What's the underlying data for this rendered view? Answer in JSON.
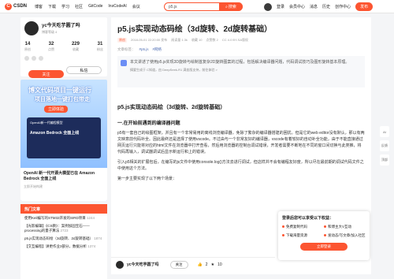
{
  "topbar": {
    "logo": "CSDN",
    "nav": [
      "博客",
      "下载",
      "学习",
      "社区",
      "GitCode",
      "InsCodeAI",
      "会议"
    ],
    "search_value": "p5.js",
    "search_button": "搜索",
    "right_items": [
      "登录",
      "会员中心",
      "消息",
      "历史",
      "创作中心"
    ],
    "publish": "发布"
  },
  "profile": {
    "name": "yc今天吃芋圆了吗",
    "sub": "博客等级 4",
    "stats": [
      {
        "n": "14",
        "l": "原创"
      },
      {
        "n": "32",
        "l": "点赞"
      },
      {
        "n": "229",
        "l": "收藏"
      },
      {
        "n": "31",
        "l": "粉丝"
      }
    ],
    "follow": "关注",
    "message": "私信"
  },
  "ad": {
    "title1": "博文代码项目一键运行",
    "title2": "项目落地一键打包带走",
    "badge": "立即体验",
    "card_line1": "OpenAI新一代编程模型",
    "card_line2": "Amazon Bedrock 全面上线",
    "foot": "OpenAI 新一代开源大模型已在 Amazon Bedrock 全面上线",
    "foot_sub": "立即开始构建"
  },
  "hot": {
    "header": "热门文章",
    "items": [
      {
        "t": "使用Keil编写的STM32开发的SIRD项目",
        "v": "1244"
      },
      {
        "t": "【光影编辑】《CS教》：案例加固宝石——processing的量子算法",
        "v": "2723"
      },
      {
        "t": "p5.js实现动态码绘（3d旋转、2d旋转基础）",
        "v": "1874"
      },
      {
        "t": "【交互编程】讲更作业3部分，数据分析",
        "v": "1374"
      }
    ]
  },
  "article": {
    "title": "p5.js实现动态码绘（3d旋转、2d旋转基础）",
    "meta_orig": "原创",
    "meta_date": "2018-05-01 22:20:00 发布",
    "meta_reads": "阅读量 1.3k",
    "meta_fav": "收藏 10",
    "meta_like": "点赞数 2",
    "meta_license": "CC 4.0 BY-SA版权",
    "tags_label": "文章标签：",
    "tags": [
      "#p5.js",
      "#网络"
    ],
    "summary": "本文讲述了使用p5.js实现3D旋转与绘制首复杂2D旋转图案的过程，包括解决编译器问题，代码调试技巧及图形旋转基本原理。",
    "summary_foot": "摘要生成于 C知道，由 DeepSeek-R1 满血版支持，前往体验 >",
    "h2": "p5.js实现动态码绘（3d旋转、2d旋转基础）",
    "h3": "一.在开始前遇到的编译器问题",
    "para1": "p5有一套自己的绘图框架，并且有一个非常易用的离线浏览编译器，免除了繁杂的编译器搭建的困扰。但是它的web editor没有默认，那以有两文映意前代码补全。因此最终还是选择了使用vscode。不过由与一个非常友好的编译器，vscode有着较好的自动补全功能，由于不能直接通过网页运行只能将对应的html文件在浏览器中打开查看，然后用浏览器的控制台调试错误，开发者需要不断地在不同的窗口间切换与此类推，将代码再输入，调试器调试后显示新运行和上的错误。",
    "para2": "引入p5相关的扩展包后，在编写的js文件中使用console.log()方法去进行调试，但这样并不会有编程友好度，所以尽在最前期的调试代码文件之中使用这个方法。",
    "para3": "第一步主要实现了以下两个场景："
  },
  "bottom_bar": {
    "name": "yc今天吃芋圆了吗",
    "follow": "关注",
    "like": "2",
    "fav": "10"
  },
  "popup": {
    "header": "登录后您可以享受以下权益：",
    "items": [
      "免费复制代码",
      "和博主大V互动",
      "下载海量资源",
      "发动态/写文章/加入社区"
    ],
    "button": "立即登录"
  },
  "rail": [
    "AI",
    "反馈",
    "顶部"
  ]
}
